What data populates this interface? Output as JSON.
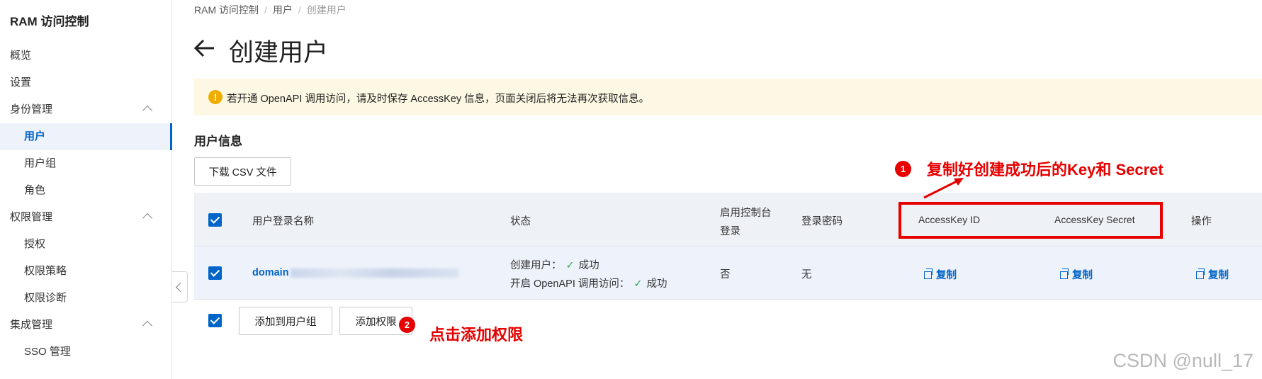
{
  "app": {
    "title": "RAM 访问控制"
  },
  "sidebar": {
    "items": [
      {
        "label": "概览"
      },
      {
        "label": "设置"
      },
      {
        "label": "身份管理"
      },
      {
        "label": "用户"
      },
      {
        "label": "用户组"
      },
      {
        "label": "角色"
      },
      {
        "label": "权限管理"
      },
      {
        "label": "授权"
      },
      {
        "label": "权限策略"
      },
      {
        "label": "权限诊断"
      },
      {
        "label": "集成管理"
      },
      {
        "label": "SSO 管理"
      }
    ]
  },
  "breadcrumb": [
    "RAM 访问控制",
    "用户",
    "创建用户"
  ],
  "page": {
    "title": "创建用户"
  },
  "alert": {
    "text": "若开通 OpenAPI 调用访问，请及时保存 AccessKey 信息，页面关闭后将无法再次获取信息。"
  },
  "section": {
    "title": "用户信息"
  },
  "buttons": {
    "download_csv": "下载 CSV 文件",
    "add_to_group": "添加到用户组",
    "add_permission": "添加权限"
  },
  "table": {
    "headers": {
      "login_name": "用户登录名称",
      "status": "状态",
      "console_login_line1": "启用控制台",
      "console_login_line2": "登录",
      "password": "登录密码",
      "access_key_id": "AccessKey ID",
      "access_key_secret": "AccessKey Secret",
      "actions": "操作"
    },
    "row": {
      "login_name": "domain",
      "status_create_label": "创建用户：",
      "status_create_value": "成功",
      "status_api_label": "开启 OpenAPI 调用访问：",
      "status_api_value": "成功",
      "check_glyph": "✓",
      "console_login": "否",
      "password": "无",
      "copy_id": "复制",
      "copy_secret": "复制",
      "copy_action": "复制"
    }
  },
  "annotations": {
    "badge1": "1",
    "text1": "复制好创建成功后的Key和 Secret",
    "badge2": "2",
    "text2": "点击添加权限",
    "color": "#e60000"
  },
  "watermark": "CSDN @null_17"
}
